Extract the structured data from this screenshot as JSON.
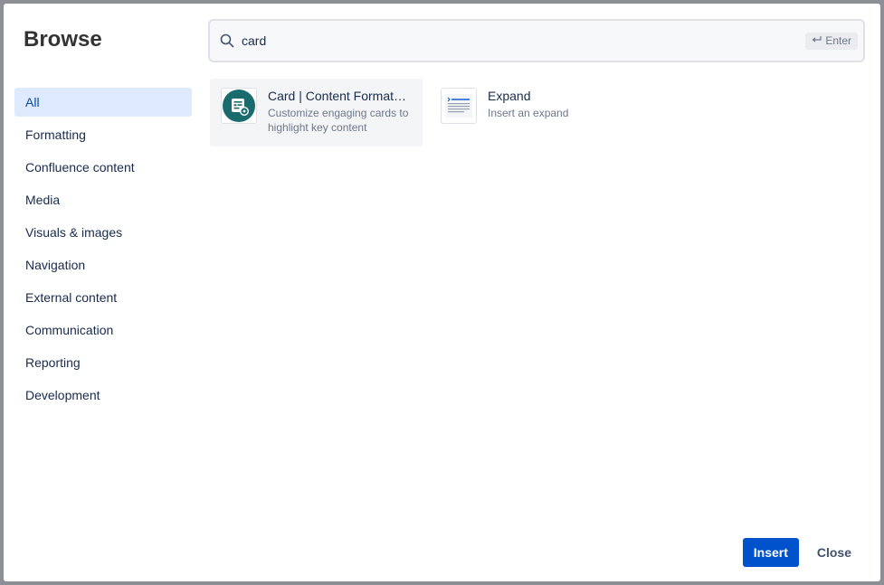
{
  "dialog": {
    "title": "Browse"
  },
  "search": {
    "value": "card",
    "placeholder": "",
    "enter_hint": "Enter",
    "enter_icon": "return-arrow-icon"
  },
  "nav": {
    "items": [
      {
        "label": "All",
        "selected": true
      },
      {
        "label": "Formatting"
      },
      {
        "label": "Confluence content"
      },
      {
        "label": "Media"
      },
      {
        "label": "Visuals & images"
      },
      {
        "label": "Navigation"
      },
      {
        "label": "External content"
      },
      {
        "label": "Communication"
      },
      {
        "label": "Reporting"
      },
      {
        "label": "Development"
      }
    ]
  },
  "results": [
    {
      "title": "Card | Content Formatt…",
      "description": "Customize engaging cards to highlight key content",
      "icon": "card-macro-icon",
      "icon_color": "#1a6b6e"
    },
    {
      "title": "Expand",
      "description": "Insert an expand",
      "icon": "expand-macro-icon"
    }
  ],
  "footer": {
    "insert_label": "Insert",
    "close_label": "Close"
  },
  "colors": {
    "primary": "#0052cc",
    "nav_selected_bg": "#deebff",
    "nav_selected_text": "#0747a6"
  }
}
